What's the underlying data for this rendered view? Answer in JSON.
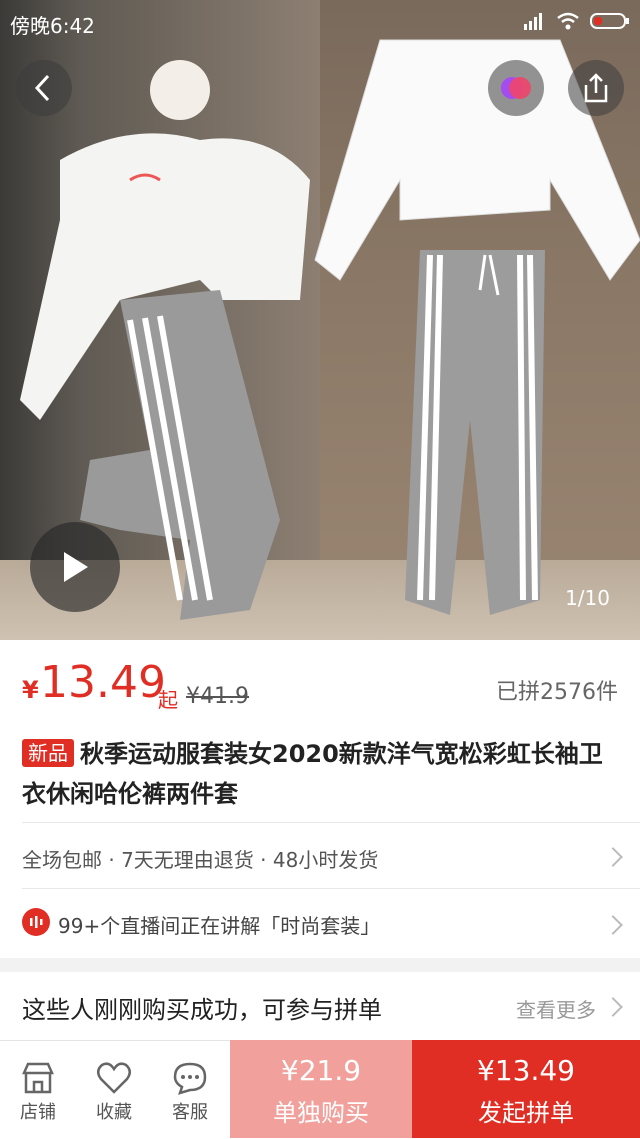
{
  "status": {
    "time": "傍晚6:42"
  },
  "hero": {
    "pager": "1/10"
  },
  "price": {
    "currency": "¥",
    "value": "13.49",
    "suffix": "起",
    "original": "¥41.9",
    "sold": "已拼2576件"
  },
  "product": {
    "tag": "新品",
    "title": "秋季运动服套装女2020新款洋气宽松彩虹长袖卫衣休闲哈伦裤两件套"
  },
  "services": {
    "text": "全场包邮 · 7天无理由退货 · 48小时发货"
  },
  "live": {
    "text": "99+个直播间正在讲解「时尚套装」"
  },
  "group": {
    "title": "这些人刚刚购买成功，可参与拼单",
    "more": "查看更多"
  },
  "bottom_nav": {
    "shop": "店铺",
    "fav": "收藏",
    "service": "客服"
  },
  "buy_solo": {
    "price": "¥21.9",
    "label": "单独购买"
  },
  "buy_group": {
    "price": "¥13.49",
    "label": "发起拼单"
  },
  "colors": {
    "accent": "#e02e24",
    "solo_bg": "#f2a09b"
  }
}
